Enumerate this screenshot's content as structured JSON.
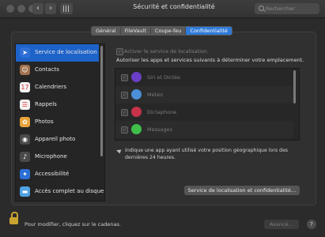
{
  "window": {
    "title": "Sécurité et confidentialité",
    "search_placeholder": "Rechercher",
    "back_icon": "‹",
    "forward_icon": "›"
  },
  "tabs": [
    {
      "label": "Général",
      "active": false
    },
    {
      "label": "FileVault",
      "active": false
    },
    {
      "label": "Coupe-feu",
      "active": false
    },
    {
      "label": "Confidentialité",
      "active": true
    }
  ],
  "sidebar": {
    "items": [
      {
        "label": "Service de localisation",
        "icon": "location-arrow-icon",
        "color": "#2f6fd6",
        "glyph": "➤",
        "selected": true
      },
      {
        "label": "Contacts",
        "icon": "contacts-icon",
        "color": "#a0714f",
        "glyph": "☺",
        "selected": false
      },
      {
        "label": "Calendriers",
        "icon": "calendar-icon",
        "color": "#f2f2f2",
        "glyph": "17",
        "selected": false
      },
      {
        "label": "Rappels",
        "icon": "reminders-icon",
        "color": "#f2f2f2",
        "glyph": "☰",
        "selected": false
      },
      {
        "label": "Photos",
        "icon": "photos-icon",
        "color": "#e7a33a",
        "glyph": "✿",
        "selected": false
      },
      {
        "label": "Appareil photo",
        "icon": "camera-icon",
        "color": "#4a4a4a",
        "glyph": "◉",
        "selected": false
      },
      {
        "label": "Microphone",
        "icon": "microphone-icon",
        "color": "#4a4a4a",
        "glyph": "♪",
        "selected": false
      },
      {
        "label": "Accessibilité",
        "icon": "accessibility-icon",
        "color": "#2b6fd6",
        "glyph": "✦",
        "selected": false
      },
      {
        "label": "Accès complet au disque",
        "icon": "folder-icon",
        "color": "#4fa3e0",
        "glyph": "▬",
        "selected": false
      }
    ]
  },
  "main": {
    "enable_label": "Activer le service de localisation",
    "allow_label": "Autoriser les apps et services suivants à déterminer votre emplacement.",
    "apps": [
      {
        "label": "Siri et Dictée",
        "icon": "siri-icon",
        "color": "#6a3fc8"
      },
      {
        "label": "Météo",
        "icon": "weather-icon",
        "color": "#4b90d9"
      },
      {
        "label": "Dictaphone",
        "icon": "dictaphone-icon",
        "color": "#c8334a"
      },
      {
        "label": "Messages",
        "icon": "messages-icon",
        "color": "#3fbf4a"
      }
    ],
    "note": "Indique une app ayant utilisé votre position géographique lors des dernières 24 heures.",
    "details_button": "Service de localisation et confidentialité…"
  },
  "footer": {
    "lock_text": "Pour modifier, cliquez sur le cadenas.",
    "advanced_button": "Avancé…",
    "help_glyph": "?"
  }
}
